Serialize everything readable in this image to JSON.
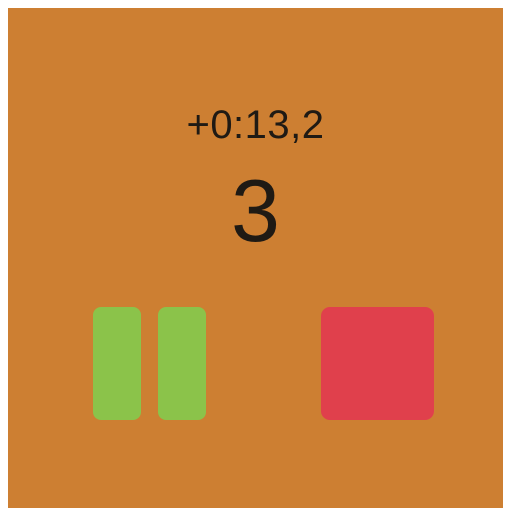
{
  "timer": {
    "elapsed": "+0:13,2",
    "count": "3"
  },
  "controls": {
    "pause_icon": "pause-icon",
    "stop_icon": "stop-icon"
  },
  "colors": {
    "background": "#cd7f32",
    "pause": "#8bc34a",
    "stop": "#e0404c",
    "text": "#1f1a14"
  }
}
